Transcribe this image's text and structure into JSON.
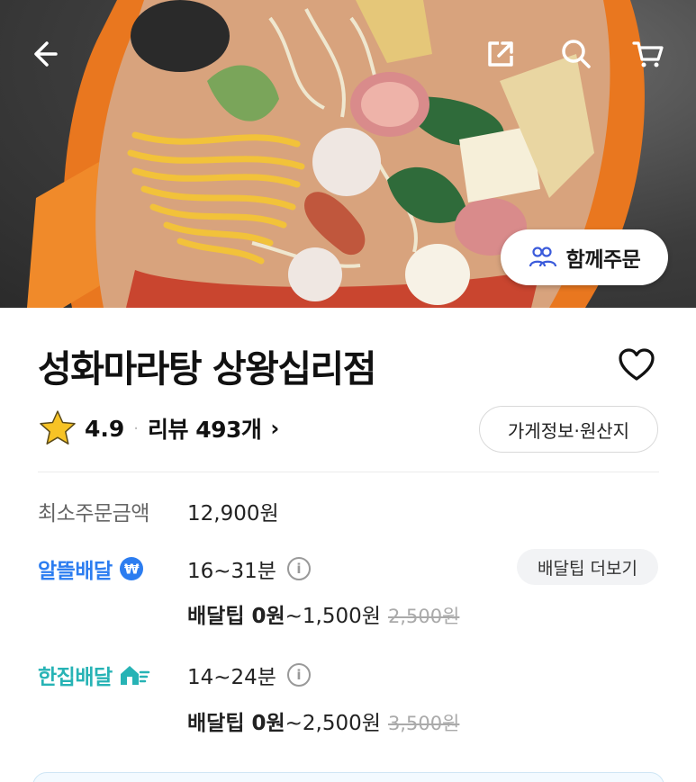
{
  "header": {
    "together_order_label": "함께주문"
  },
  "store": {
    "name": "성화마라탕 상왕십리점",
    "rating": "4.9",
    "separator": "·",
    "reviews_label": "리뷰 493개",
    "info_button_label": "가게정보·원산지"
  },
  "min_order": {
    "label": "최소주문금액",
    "value": "12,900원"
  },
  "delivery": [
    {
      "type_label": "알뜰배달",
      "time": "16~31분",
      "fee_prefix": "배달팁 0원",
      "fee_range": "~1,500원",
      "original_fee": "2,500원",
      "color": "#2c7df0"
    },
    {
      "type_label": "한집배달",
      "time": "14~24분",
      "fee_prefix": "배달팁 0원",
      "fee_range": "~2,500원",
      "original_fee": "3,500원",
      "color": "#27b3b5"
    }
  ],
  "more_tip_label": "배달팁 더보기",
  "icons": {
    "back": "back-arrow-icon",
    "share": "share-icon",
    "search": "search-icon",
    "cart": "cart-icon",
    "heart": "heart-icon",
    "star": "star-icon",
    "info": "info-icon",
    "users": "users-icon"
  },
  "colors": {
    "accent_blue": "#2c7df0",
    "accent_teal": "#27b3b5",
    "star": "#f7c325"
  }
}
